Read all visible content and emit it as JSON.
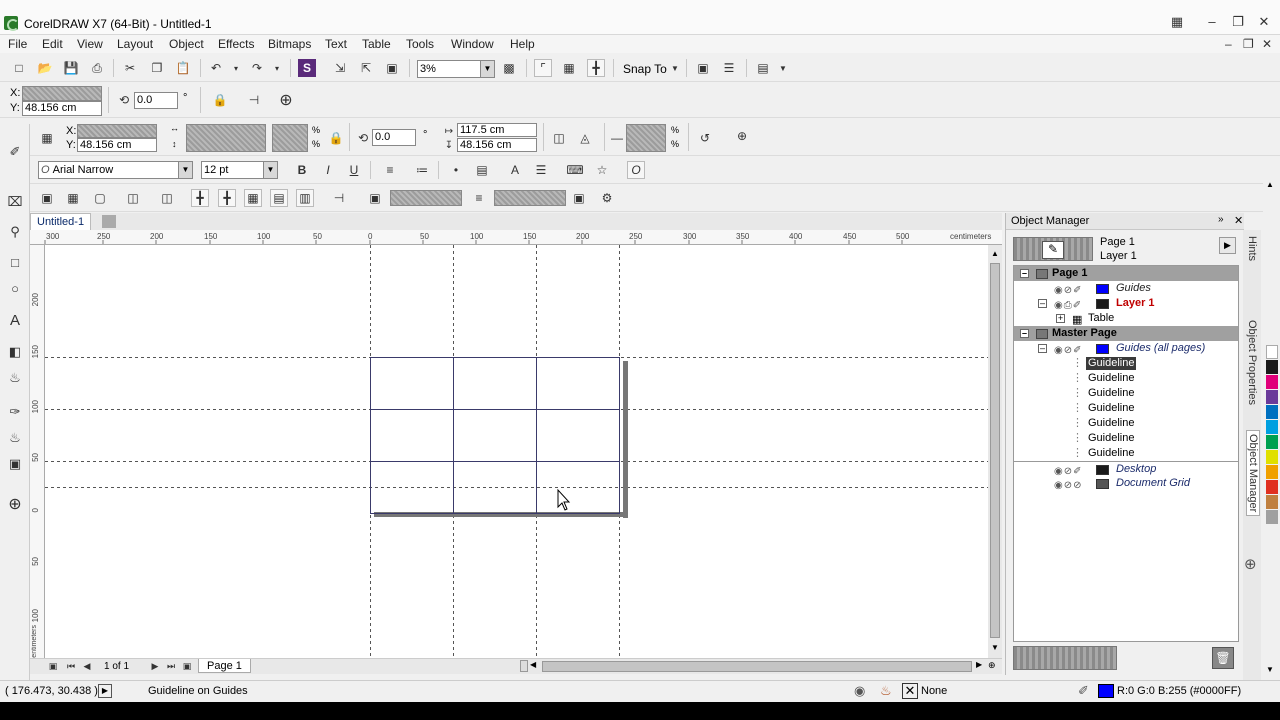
{
  "window": {
    "title": "CorelDRAW X7 (64-Bit) - Untitled-1"
  },
  "menu": [
    "File",
    "Edit",
    "View",
    "Layout",
    "Object",
    "Effects",
    "Bitmaps",
    "Text",
    "Table",
    "Tools",
    "Window",
    "Help"
  ],
  "standard_toolbar": {
    "zoom_level": "3%",
    "snap_to_label": "Snap To"
  },
  "property_bar_1": {
    "x_label": "X:",
    "y_label": "Y:",
    "y_value": "48.156 cm",
    "angle_value": "0.0",
    "degree": "°"
  },
  "property_bar_2": {
    "x_label": "X:",
    "y_label": "Y:",
    "y_value": "48.156 cm",
    "percent": "%",
    "angle_value": "0.0",
    "degree": "°",
    "width_value": "117.5 cm",
    "height_value": "48.156 cm"
  },
  "text_bar": {
    "font_name": "Arial Narrow",
    "font_size": "12 pt"
  },
  "document": {
    "tab": "Untitled-1",
    "page_counter": "1 of 1",
    "page_tab": "Page 1"
  },
  "ruler": {
    "h_labels": [
      "300",
      "250",
      "200",
      "150",
      "100",
      "50",
      "0",
      "50",
      "100",
      "150",
      "200",
      "250",
      "300",
      "350",
      "400",
      "450",
      "500"
    ],
    "unit": "centimeters",
    "v_labels": [
      "200",
      "150",
      "100",
      "50",
      "0",
      "50",
      "100"
    ],
    "v_unit": "centimeters"
  },
  "object_manager": {
    "title": "Object Manager",
    "current_page": "Page 1",
    "current_layer": "Layer 1",
    "rows": [
      {
        "label": "Page 1",
        "kind": "page"
      },
      {
        "label": "Guides",
        "kind": "layer",
        "color": "#0000ff",
        "style": "italic"
      },
      {
        "label": "Layer 1",
        "kind": "layer",
        "color": "#1a1a1a",
        "style": "active"
      },
      {
        "label": "Table",
        "kind": "object"
      },
      {
        "label": "Master Page",
        "kind": "page"
      },
      {
        "label": "Guides (all pages)",
        "kind": "layer",
        "color": "#0000ff",
        "style": "italic"
      },
      {
        "label": "Guideline",
        "kind": "guide",
        "selected": true
      },
      {
        "label": "Guideline",
        "kind": "guide"
      },
      {
        "label": "Guideline",
        "kind": "guide"
      },
      {
        "label": "Guideline",
        "kind": "guide"
      },
      {
        "label": "Guideline",
        "kind": "guide"
      },
      {
        "label": "Guideline",
        "kind": "guide"
      },
      {
        "label": "Guideline",
        "kind": "guide"
      },
      {
        "label": "Desktop",
        "kind": "layer",
        "color": "#1a1a1a",
        "style": "italic"
      },
      {
        "label": "Document Grid",
        "kind": "layer",
        "color": "#555555",
        "style": "italic"
      }
    ]
  },
  "side_tabs": [
    "Hints",
    "Object Properties",
    "Object Manager"
  ],
  "status": {
    "coords": "( 176.473, 30.438 )",
    "message": "Guideline on Guides",
    "outline": "None",
    "fill_color": "#0000ff",
    "fill_info": "R:0 G:0 B:255 (#0000FF)"
  },
  "palette_colors": [
    "#ffffff",
    "#1a1a1a",
    "#e0007a",
    "#6a3a9a",
    "#0070c0",
    "#00a0e0",
    "#00a050",
    "#e0e000",
    "#f0a000",
    "#e03020",
    "#c08040",
    "#a0a0a0"
  ]
}
